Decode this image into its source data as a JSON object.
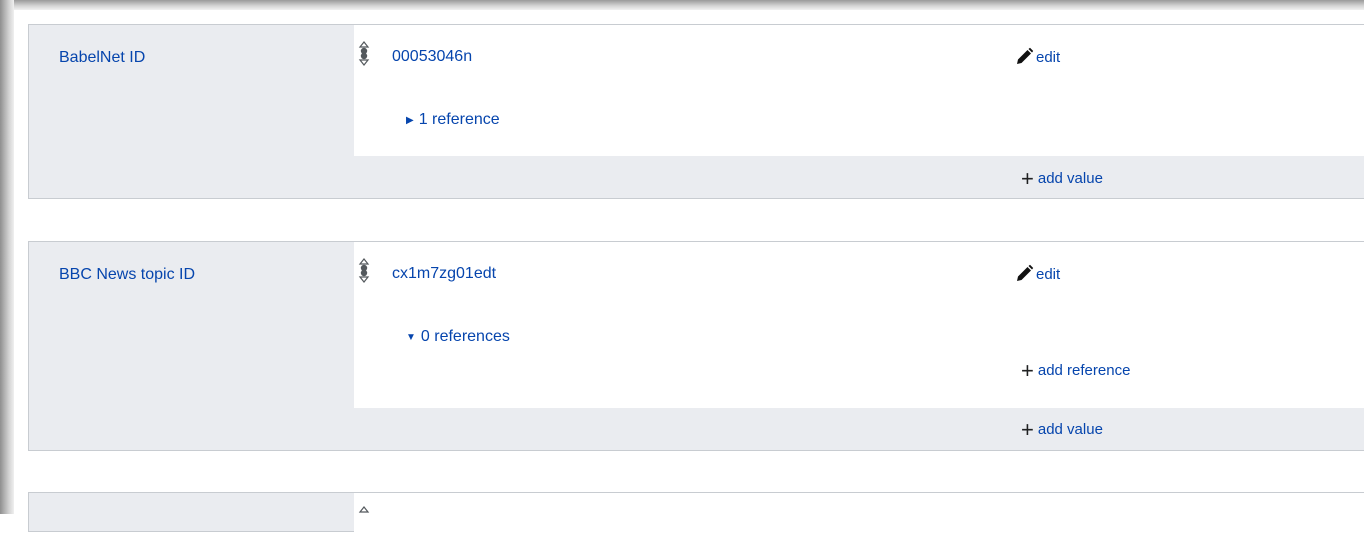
{
  "statements": [
    {
      "property_label": "BabelNet ID",
      "value": "00053046n",
      "edit_label": "edit",
      "references_label": "1 reference",
      "references_expanded": false,
      "add_value_label": "add value"
    },
    {
      "property_label": "BBC News topic ID",
      "value": "cx1m7zg01edt",
      "edit_label": "edit",
      "references_label": "0 references",
      "references_expanded": true,
      "add_reference_label": "add reference",
      "add_value_label": "add value"
    }
  ],
  "icons": {
    "rank": "rank-normal-icon",
    "edit": "pencil-icon",
    "add": "plus-icon",
    "collapsed": "triangle-right-icon",
    "expanded": "triangle-down-icon"
  },
  "colors": {
    "link": "#0645ad",
    "group_background": "#eaecf0",
    "border": "#c8ccd1"
  }
}
